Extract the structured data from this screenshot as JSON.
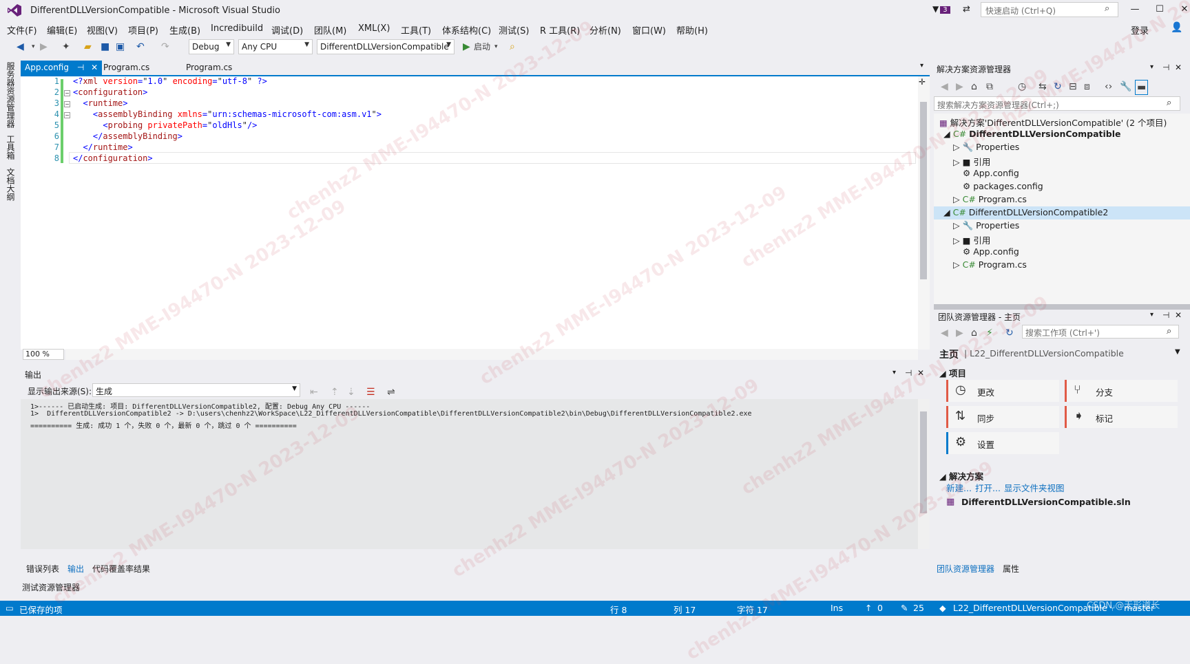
{
  "window": {
    "title": "DifferentDLLVersionCompatible - Microsoft Visual Studio",
    "notification_count": "3",
    "quick_launch_placeholder": "快速启动 (Ctrl+Q)",
    "login": "登录"
  },
  "menu": [
    "文件(F)",
    "编辑(E)",
    "视图(V)",
    "项目(P)",
    "生成(B)",
    "Incredibuild",
    "调试(D)",
    "团队(M)",
    "XML(X)",
    "工具(T)",
    "体系结构(C)",
    "测试(S)",
    "R 工具(R)",
    "分析(N)",
    "窗口(W)",
    "帮助(H)"
  ],
  "toolbar": {
    "config": "Debug",
    "platform": "Any CPU",
    "startup_project": "DifferentDLLVersionCompatible",
    "start": "启动"
  },
  "left_tabs": [
    "服务器资源管理器",
    "工具箱",
    "文档大纲"
  ],
  "doc_tabs": [
    "App.config",
    "Program.cs",
    "Program.cs"
  ],
  "editor": {
    "line_numbers": [
      "1",
      "2",
      "3",
      "4",
      "5",
      "6",
      "7",
      "8"
    ],
    "zoom": "100 %"
  },
  "output": {
    "title": "输出",
    "source_label": "显示输出来源(S):",
    "source_value": "生成",
    "lines": [
      "1>------ 已启动生成: 项目: DifferentDLLVersionCompatible2, 配置: Debug Any CPU ------",
      "1>  DifferentDLLVersionCompatible2 -> D:\\users\\chenhz2\\WorkSpace\\L22_DifferentDLLVersionCompatible\\DifferentDLLVersionCompatible2\\bin\\Debug\\DifferentDLLVersionCompatible2.exe",
      "========== 生成: 成功 1 个，失败 0 个，最新 0 个，跳过 0 个 =========="
    ]
  },
  "bottom_tabs": [
    "错误列表",
    "输出",
    "代码覆盖率结果"
  ],
  "test_explorer": "测试资源管理器",
  "solution_explorer": {
    "title": "解决方案资源管理器",
    "search_placeholder": "搜索解决方案资源管理器(Ctrl+;)",
    "tree": [
      "解决方案'DifferentDLLVersionCompatible' (2 个项目)",
      "DifferentDLLVersionCompatible",
      "Properties",
      "引用",
      "App.config",
      "packages.config",
      "Program.cs",
      "DifferentDLLVersionCompatible2",
      "Properties",
      "引用",
      "App.config",
      "Program.cs"
    ]
  },
  "team_explorer": {
    "title": "团队资源管理器 - 主页",
    "search_placeholder": "搜索工作项 (Ctrl+')",
    "home": "主页",
    "project": "| L22_DifferentDLLVersionCompatible",
    "section_project": "项目",
    "buttons": [
      "更改",
      "分支",
      "同步",
      "标记",
      "设置"
    ],
    "section_solution": "解决方案",
    "links": [
      "新建...",
      "打开...",
      "显示文件夹视图"
    ],
    "sln_file": "DifferentDLLVersionCompatible.sln"
  },
  "right_tabs": [
    "团队资源管理器",
    "属性"
  ],
  "status": {
    "saved": "已保存的项",
    "line": "行 8",
    "col": "列 17",
    "ch": "字符 17",
    "ins": "Ins",
    "up": "0",
    "edits": "25",
    "repo": "L22_DifferentDLLVersionCompatible",
    "branch": "master"
  },
  "watermark": "chenhz2 MME-I94470-N 2023-12-09",
  "csdn": "CSDN @无形道长",
  "colors": {
    "accent": "#007acc",
    "vs_purple": "#68217a",
    "change_bar": "#6bce6b"
  }
}
